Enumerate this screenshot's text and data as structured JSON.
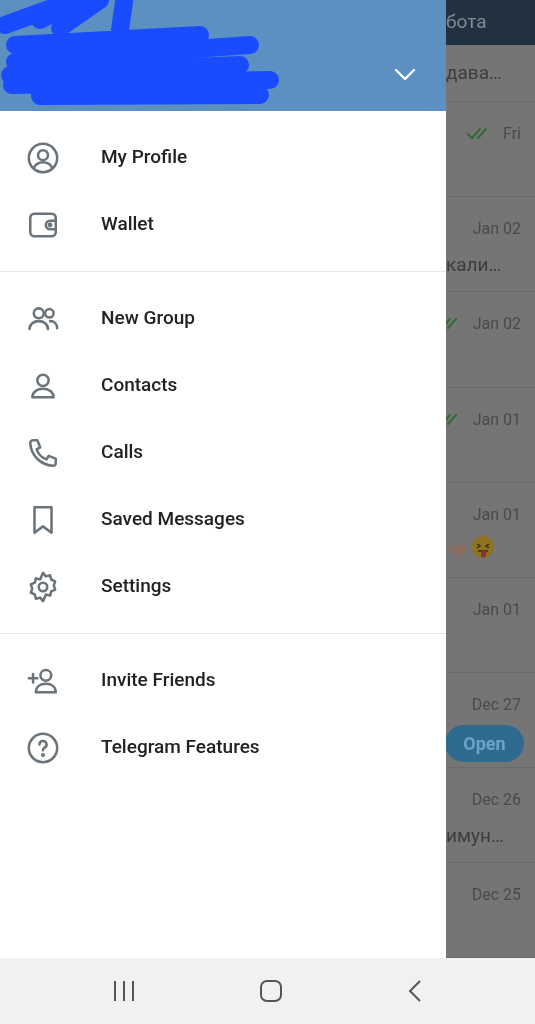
{
  "drawer": {
    "sections": [
      {
        "items": [
          {
            "label": "My Profile"
          },
          {
            "label": "Wallet"
          }
        ]
      },
      {
        "items": [
          {
            "label": "New Group"
          },
          {
            "label": "Contacts"
          },
          {
            "label": "Calls"
          },
          {
            "label": "Saved Messages"
          },
          {
            "label": "Settings"
          }
        ]
      },
      {
        "items": [
          {
            "label": "Invite Friends"
          },
          {
            "label": "Telegram Features"
          }
        ]
      }
    ]
  },
  "chat_list": {
    "title": "бота",
    "rows": [
      {
        "kind": "tail",
        "preview": "дава…"
      },
      {
        "kind": "chat",
        "time": "Fri",
        "read": true
      },
      {
        "kind": "chat",
        "time": "Jan 02",
        "read": false,
        "preview": "кали…"
      },
      {
        "kind": "chat",
        "time": "Jan 02",
        "read": true
      },
      {
        "kind": "chat",
        "time": "Jan 01",
        "read": true
      },
      {
        "kind": "emoji",
        "time": "Jan 01",
        "read": false
      },
      {
        "kind": "chat",
        "time": "Jan 01",
        "read": false
      },
      {
        "kind": "chat",
        "time": "Dec 27",
        "read": false,
        "button": "Open"
      },
      {
        "kind": "chat",
        "time": "Dec 26",
        "read": false,
        "preview": "имун…"
      },
      {
        "kind": "chat",
        "time": "Dec 25",
        "read": false
      }
    ]
  }
}
